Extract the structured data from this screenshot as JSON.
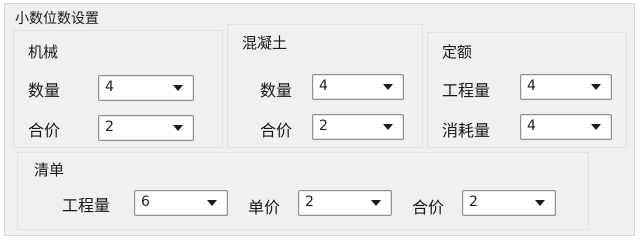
{
  "panel": {
    "title": "小数位数设置"
  },
  "machine": {
    "title": "机械",
    "quantity": {
      "label": "数量",
      "value": "4"
    },
    "total": {
      "label": "合价",
      "value": "2"
    }
  },
  "concrete": {
    "title": "混凝土",
    "quantity": {
      "label": "数量",
      "value": "4"
    },
    "total": {
      "label": "合价",
      "value": "2"
    }
  },
  "quota": {
    "title": "定额",
    "work_quantity": {
      "label": "工程量",
      "value": "4"
    },
    "consumption": {
      "label": "消耗量",
      "value": "4"
    }
  },
  "bill": {
    "title": "清单",
    "work_quantity": {
      "label": "工程量",
      "value": "6"
    },
    "unit_price": {
      "label": "单价",
      "value": "2"
    },
    "total": {
      "label": "合价",
      "value": "2"
    }
  }
}
